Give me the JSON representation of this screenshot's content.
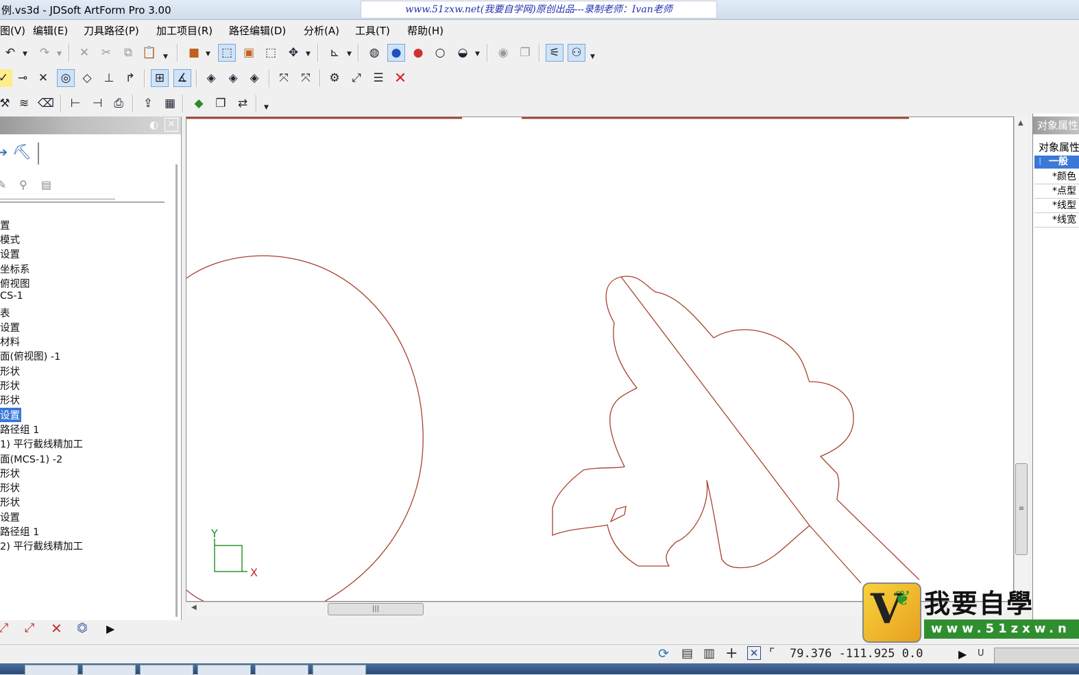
{
  "window": {
    "title": "例.vs3d - JDSoft ArtForm Pro 3.00",
    "watermark": "www.51zxw.net(我要自学网)原创出品---录制老师：Ivan老师"
  },
  "menu": [
    {
      "label": "图(V)"
    },
    {
      "label": "编辑(E)"
    },
    {
      "label": "刀具路径(P)"
    },
    {
      "label": "加工项目(R)"
    },
    {
      "label": "路径编辑(D)"
    },
    {
      "label": "分析(A)"
    },
    {
      "label": "工具(T)"
    },
    {
      "label": "帮助(H)"
    }
  ],
  "tree": [
    {
      "label": "置"
    },
    {
      "label": "模式"
    },
    {
      "label": "设置"
    },
    {
      "label": "坐标系"
    },
    {
      "label": "俯视图"
    },
    {
      "label": "CS-1"
    },
    {
      "label": "表"
    },
    {
      "label": "设置"
    },
    {
      "label": "材料"
    },
    {
      "label": "面(俯视图) -1"
    },
    {
      "label": "形状"
    },
    {
      "label": "形状"
    },
    {
      "label": "形状"
    },
    {
      "label": "设置",
      "selected": true
    },
    {
      "label": "路径组 1"
    },
    {
      "label": "1) 平行截线精加工"
    },
    {
      "label": "面(MCS-1) -2"
    },
    {
      "label": "形状"
    },
    {
      "label": "形状"
    },
    {
      "label": "形状"
    },
    {
      "label": "设置"
    },
    {
      "label": "路径组 1"
    },
    {
      "label": "2) 平行截线精加工"
    }
  ],
  "canvas": {
    "axis_x": "X",
    "axis_y": "Y",
    "curve_color": "#a8402a",
    "axis_color": "#1f8f1f"
  },
  "right_panel": {
    "header": "对象属性",
    "subheader": "对象属性",
    "group": "一般",
    "props": [
      "*颜色",
      "*点型",
      "*线型",
      "*线宽"
    ]
  },
  "status": {
    "coords": "79.376 -111.925 0.0",
    "mode": "U"
  },
  "logo": {
    "text": "我要自學",
    "url": "www.51zxw.n"
  },
  "colors": {
    "selection": "#3b78d8",
    "close_red": "#e02020"
  }
}
